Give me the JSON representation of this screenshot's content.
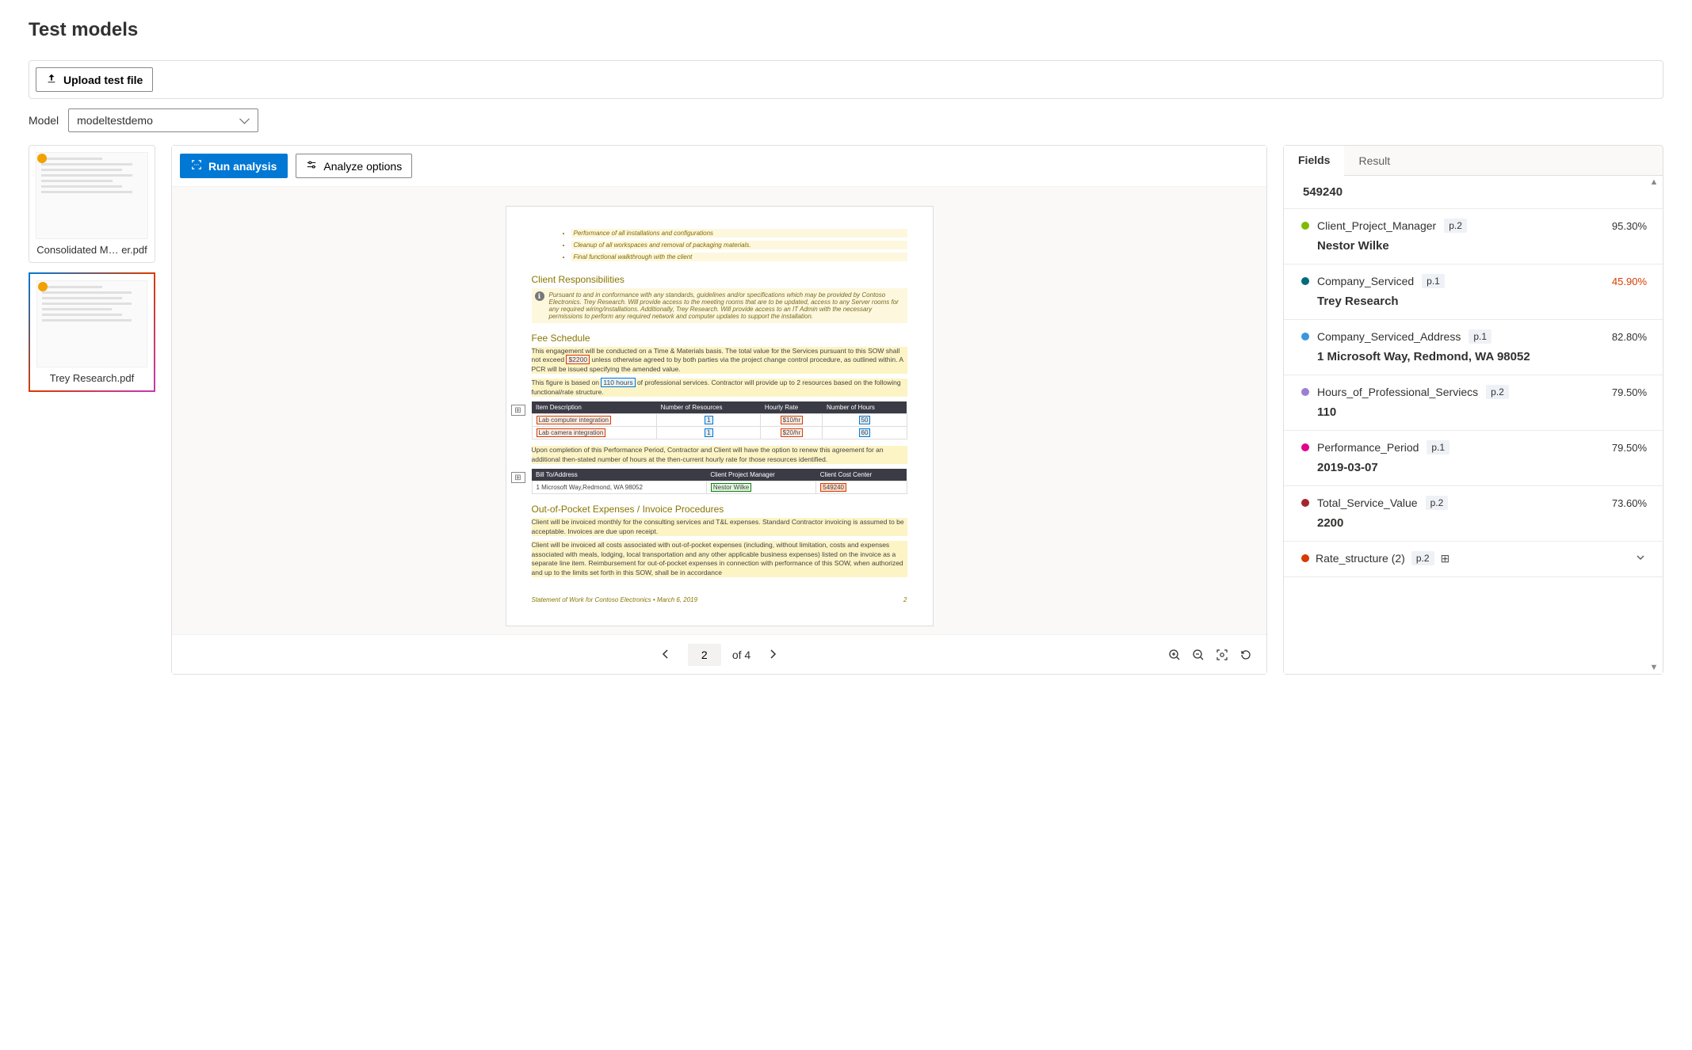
{
  "page_title": "Test models",
  "upload_button": "Upload test file",
  "model_label": "Model",
  "model_selected": "modeltestdemo",
  "thumbnails": [
    {
      "name": "Consolidated M… er.pdf",
      "active": false
    },
    {
      "name": "Trey Research.pdf",
      "active": true
    }
  ],
  "toolbar": {
    "run": "Run analysis",
    "analyze_options": "Analyze options"
  },
  "pager": {
    "current": "2",
    "total_label": "of 4"
  },
  "tabs": {
    "fields": "Fields",
    "result": "Result"
  },
  "top_value": "549240",
  "fields": [
    {
      "color": "#7fba00",
      "name": "Client_Project_Manager",
      "page": "p.2",
      "conf": "95.30%",
      "value": "Nestor Wilke"
    },
    {
      "color": "#006b7d",
      "name": "Company_Serviced",
      "page": "p.1",
      "conf": "45.90%",
      "low": true,
      "value": "Trey Research"
    },
    {
      "color": "#3a96dd",
      "name": "Company_Serviced_Address",
      "page": "p.1",
      "conf": "82.80%",
      "value": "1 Microsoft Way, Redmond, WA 98052"
    },
    {
      "color": "#9b7fd4",
      "name": "Hours_of_Professional_Serviecs",
      "page": "p.2",
      "conf": "79.50%",
      "value": "110"
    },
    {
      "color": "#e3008c",
      "name": "Performance_Period",
      "page": "p.1",
      "conf": "79.50%",
      "value": "2019-03-07"
    },
    {
      "color": "#a4262c",
      "name": "Total_Service_Value",
      "page": "p.2",
      "conf": "73.60%",
      "value": "2200"
    }
  ],
  "rate_field": {
    "color": "#d83b01",
    "name": "Rate_structure (2)",
    "page": "p.2"
  },
  "doc": {
    "bullets": [
      "Performance of all installations and configurations",
      "Cleanup of all workspaces and removal of packaging materials.",
      "Final functional walkthrough with the client"
    ],
    "h_client": "Client Responsibilities",
    "client_note": "Pursuant to and in conformance with any standards, guidelines and/or specifications which may be provided by Contoso Electronics. Trey Research. Will provide access to the meeting rooms that are to be updated, access to any Server rooms for any required wiring/installations. Additionally, Trey Research. Will provide access to an IT Admin with the necessary permissions to perform any required network and computer updates to support the installation.",
    "h_fee": "Fee Schedule",
    "fee_p1a": "This engagement will be conducted on a Time & Materials basis. The total value for the Services pursuant to this SOW shall not exceed ",
    "fee_total": "$2200",
    "fee_p1b": " unless otherwise agreed to by both parties via the project change control procedure, as outlined within. A PCR will be issued specifying the amended value.",
    "fee_p2a": "This figure is based on ",
    "fee_hours": "110 hours",
    "fee_p2b": " of professional services. Contractor will provide up to 2 resources based on the following functional/rate structure.",
    "rates": {
      "headers": [
        "Item Description",
        "Number of Resources",
        "Hourly Rate",
        "Number of Hours"
      ],
      "rows": [
        [
          "Lab computer integration",
          "1",
          "$10/hr",
          "50"
        ],
        [
          "Lab camera integration",
          "1",
          "$20/hr",
          "60"
        ]
      ]
    },
    "fee_p3": "Upon completion of this Performance Period, Contractor and Client will have the option to renew this agreement for an additional then-stated number of hours at the then-current hourly rate for those resources identified.",
    "bill": {
      "headers": [
        "Bill To/Address",
        "Client Project Manager",
        "Client Cost Center"
      ],
      "row": [
        "1 Microsoft Way,Redmond, WA 98052",
        "Nestor Wilke",
        "549240"
      ]
    },
    "h_oop": "Out-of-Pocket Expenses / Invoice Procedures",
    "oop_p1": "Client will be invoiced monthly for the consulting services and T&L expenses. Standard Contractor invoicing is assumed to be acceptable. Invoices are due upon receipt.",
    "oop_p2": "Client will be invoiced all costs associated with out-of-pocket expenses (including, without limitation, costs and expenses associated with meals, lodging, local transportation and any other applicable business expenses) listed on the invoice as a separate line item. Reimbursement for out-of-pocket expenses in connection with performance of this SOW, when authorized and up to the limits set forth in this SOW, shall be in accordance",
    "footer_l": "Statement of Work for Contoso Electronics • March 6, 2019",
    "footer_r": "2"
  }
}
